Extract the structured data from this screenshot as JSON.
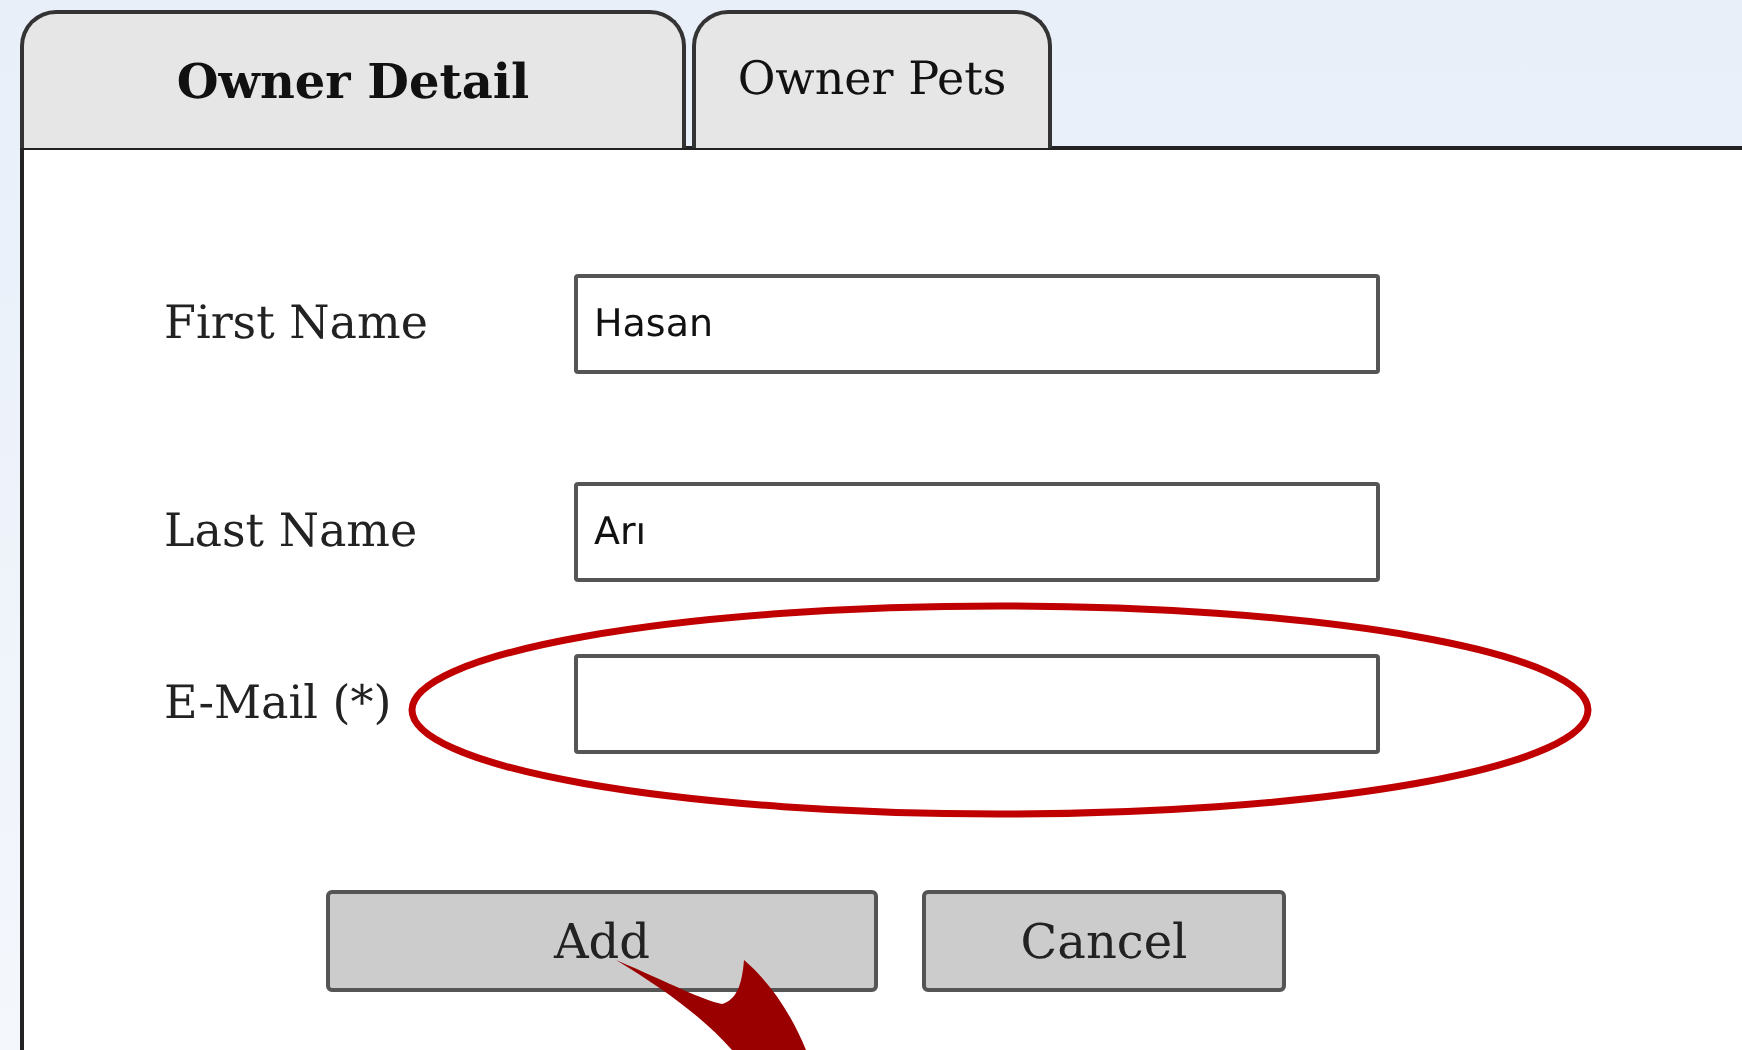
{
  "tabs": [
    {
      "label": "Owner Detail",
      "selected": true
    },
    {
      "label": "Owner Pets",
      "selected": false
    }
  ],
  "fields": [
    {
      "label": "First Name",
      "value": "Hasan"
    },
    {
      "label": "Last Name",
      "value": "Arı"
    },
    {
      "label": "E-Mail (*)"
    }
  ],
  "buttons": [
    "Add",
    "Cancel"
  ]
}
